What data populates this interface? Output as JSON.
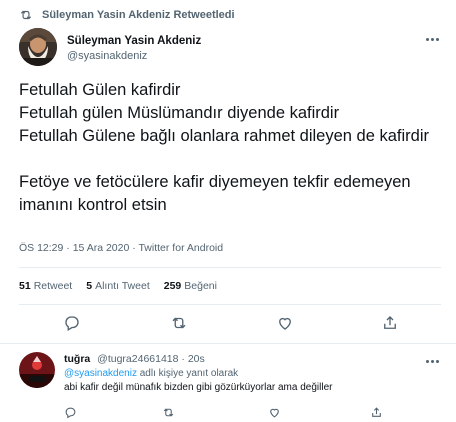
{
  "retweet": {
    "text": "Süleyman Yasin Akdeniz Retweetledi",
    "icon": "retweet-icon"
  },
  "author": {
    "name": "Süleyman Yasin Akdeniz",
    "handle": "@syasinakdeniz"
  },
  "tweet": {
    "lines": [
      "Fetullah Gülen kafirdir",
      "Fetullah gülen Müslümandır diyende kafirdir",
      "Fetullah Gülene bağlı olanlara rahmet dileyen de kafirdir",
      "Fetöye ve fetöcülere kafir diyemeyen tekfir edemeyen imanını kontrol etsin"
    ],
    "meta": "ÖS 12:29 · 15 Ara 2020 · Twitter for Android"
  },
  "stats": {
    "retweets_count": "51",
    "retweets_label": "Retweet",
    "quotes_count": "5",
    "quotes_label": "Alıntı Tweet",
    "likes_count": "259",
    "likes_label": "Beğeni"
  },
  "actions": [
    "reply-icon",
    "retweet-icon",
    "like-icon",
    "share-icon"
  ],
  "reply": {
    "name": "tuğra",
    "handle": "@tugra24661418",
    "time": "· 20s",
    "mention": "@syasinakdeniz",
    "reply_suffix": "adlı kişiye yanıt olarak",
    "text": "abi kafir değil münafık bizden gibi gözürküyorlar ama değiller"
  },
  "colors": {
    "text": "#0f1419",
    "muted": "#536471",
    "link": "#1d9bf0",
    "border": "#e6ecf0"
  }
}
